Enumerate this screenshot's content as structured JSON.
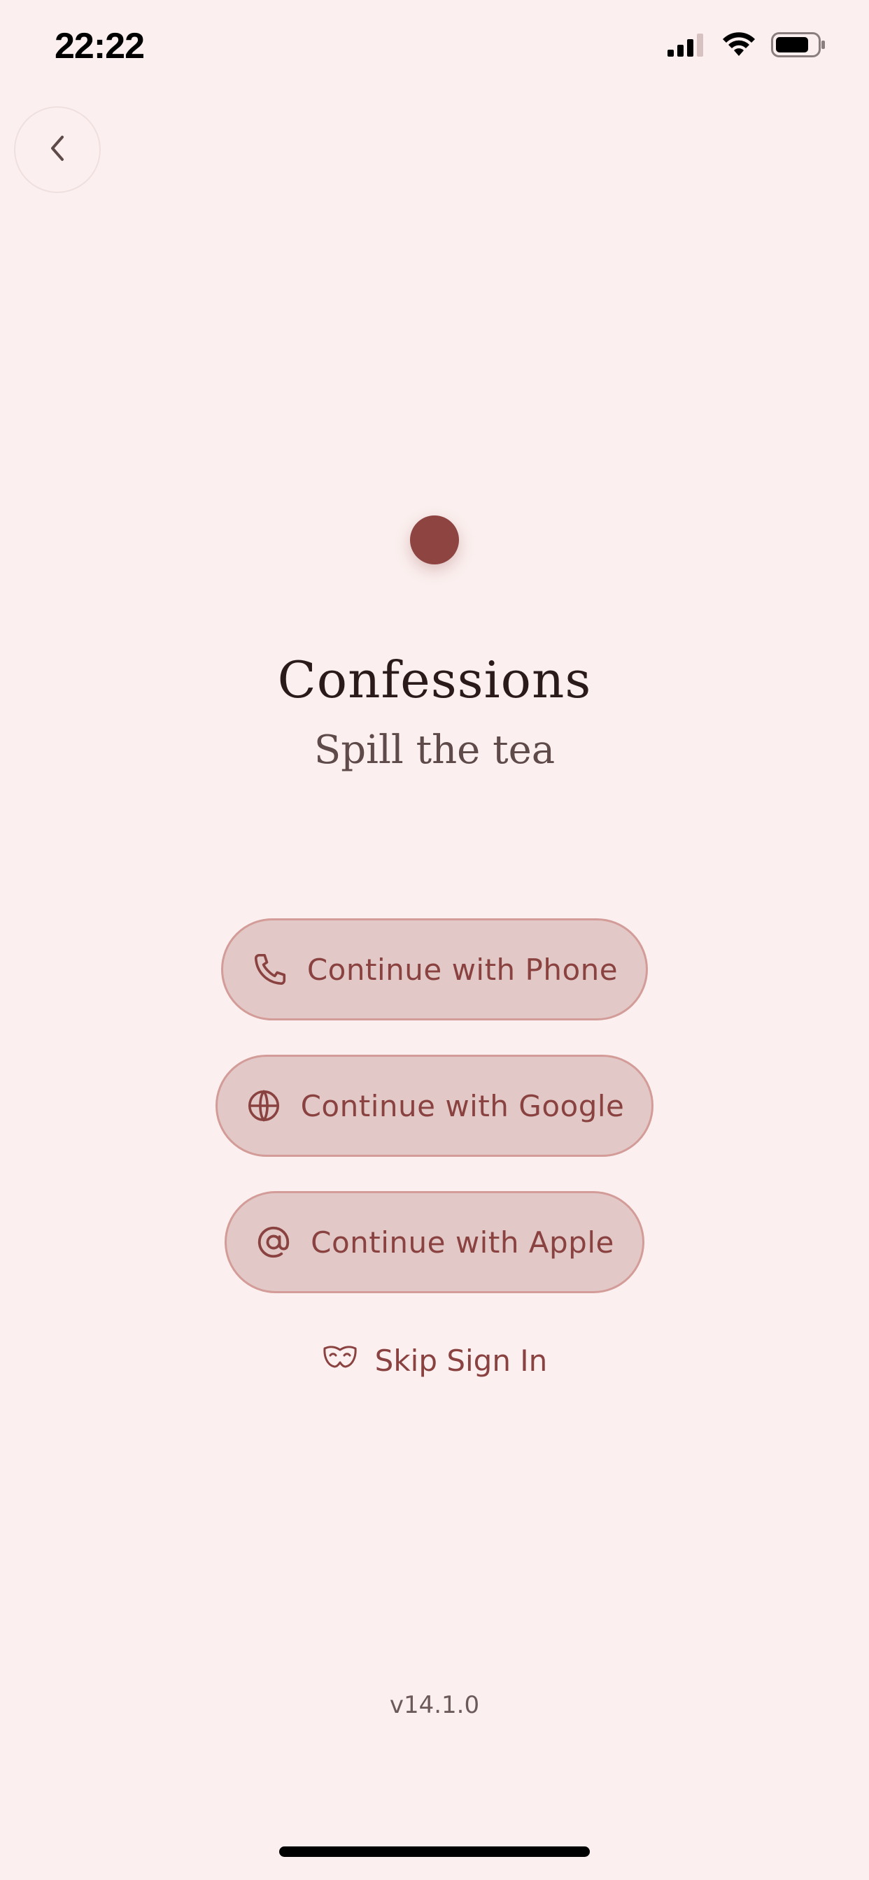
{
  "status_bar": {
    "time": "22:22",
    "icons": [
      "cellular-signal-icon",
      "wifi-icon",
      "battery-icon"
    ]
  },
  "nav": {
    "back_icon": "chevron-left-icon"
  },
  "brand": {
    "title": "Confessions",
    "subtitle": "Spill the tea",
    "accent_color": "#8e4542"
  },
  "auth": {
    "buttons": [
      {
        "label": "Continue with Phone",
        "icon": "phone-icon"
      },
      {
        "label": "Continue with Google",
        "icon": "globe-icon"
      },
      {
        "label": "Continue with Apple",
        "icon": "at-sign-icon"
      }
    ],
    "skip_label": "Skip Sign In",
    "skip_icon": "mask-icon"
  },
  "footer": {
    "version": "v14.1.0"
  },
  "colors": {
    "background": "#fbf0ef",
    "button_fill": "#e2c9c7",
    "button_border": "#d39c98",
    "button_text": "#8a4240"
  }
}
